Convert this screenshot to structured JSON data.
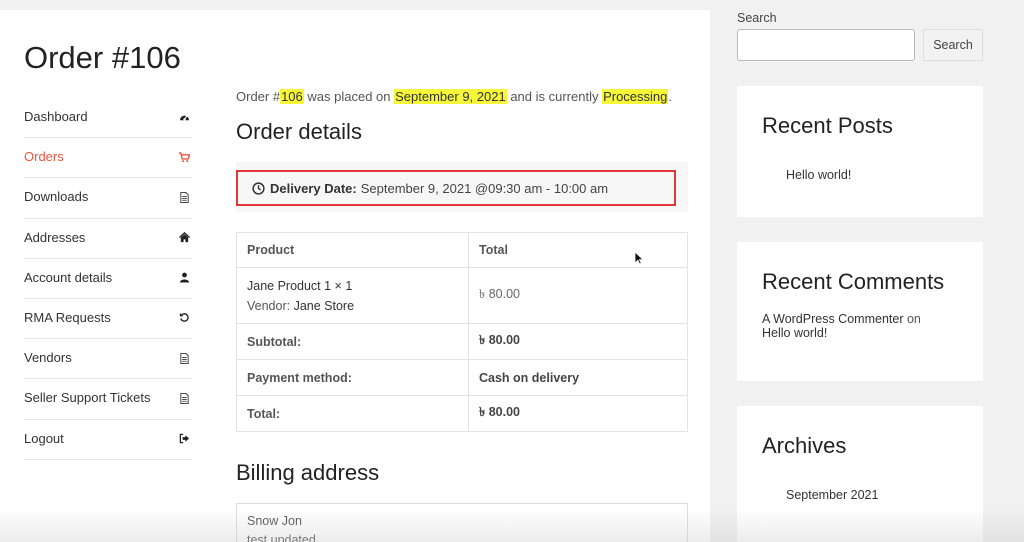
{
  "page": {
    "title": "Order #106"
  },
  "nav": {
    "items": [
      {
        "label": "Dashboard",
        "icon": "dashboard-icon"
      },
      {
        "label": "Orders",
        "icon": "cart-icon",
        "active": true
      },
      {
        "label": "Downloads",
        "icon": "file-icon"
      },
      {
        "label": "Addresses",
        "icon": "home-icon"
      },
      {
        "label": "Account details",
        "icon": "user-icon"
      },
      {
        "label": "RMA Requests",
        "icon": "undo-icon"
      },
      {
        "label": "Vendors",
        "icon": "file-icon"
      },
      {
        "label": "Seller Support Tickets",
        "icon": "file-icon"
      },
      {
        "label": "Logout",
        "icon": "logout-icon"
      }
    ],
    "active_color": "#e9543f"
  },
  "order": {
    "intro_prefix": "Order #",
    "number": "106",
    "intro_mid": " was placed on ",
    "date": "September 9, 2021",
    "intro_mid2": " and is currently ",
    "status": "Processing",
    "intro_suffix": ".",
    "details_title": "Order details",
    "delivery_label": "Delivery Date:",
    "delivery_value": "September 9, 2021 @09:30 am - 10:00 am",
    "table": {
      "col_product": "Product",
      "col_total": "Total",
      "product_name": "Jane Product 1 × 1",
      "vendor_label": "Vendor:",
      "vendor_name": "Jane Store",
      "product_price": "৳ 80.00",
      "subtotal_label": "Subtotal:",
      "subtotal_value": "৳ 80.00",
      "payment_label": "Payment method:",
      "payment_value": "Cash on delivery",
      "total_label": "Total:",
      "total_value": "৳ 80.00"
    },
    "billing_title": "Billing address",
    "billing_lines": [
      "Snow Jon",
      "test updated"
    ]
  },
  "sidebar": {
    "search_label": "Search",
    "search_value": "",
    "search_button": "Search",
    "recent_posts_title": "Recent Posts",
    "recent_posts": [
      "Hello world!"
    ],
    "recent_comments_title": "Recent Comments",
    "comment_author": "A WordPress Commenter",
    "comment_on": "on",
    "comment_post": "Hello world!",
    "archives_title": "Archives",
    "archives": [
      "September 2021"
    ]
  },
  "colors": {
    "highlight": "#f7f73a",
    "delivery_border": "#e0383b"
  }
}
